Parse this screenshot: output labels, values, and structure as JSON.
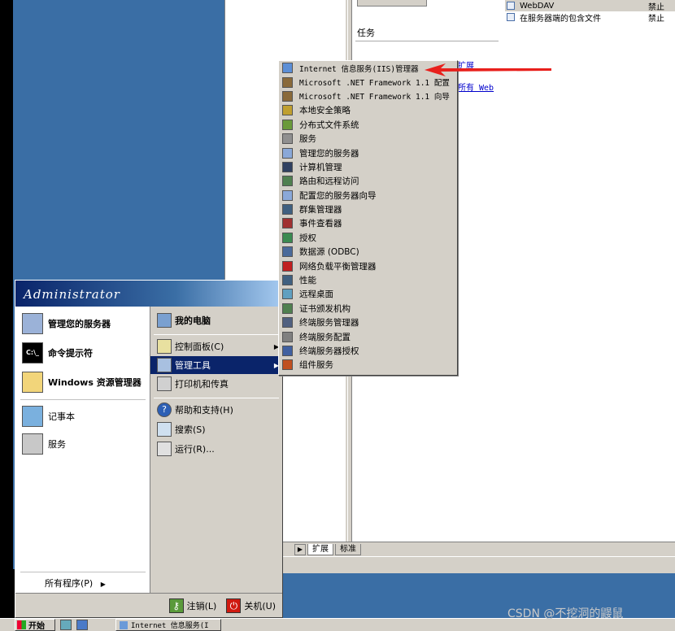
{
  "iis_window": {
    "tasks_label": "任务",
    "links": [
      "扩展",
      "所有 Web"
    ],
    "list": [
      {
        "name": "WebDAV",
        "status": "禁止"
      },
      {
        "name": "在服务器端的包含文件",
        "status": "禁止"
      }
    ],
    "tabs": [
      "扩展",
      "标准"
    ]
  },
  "start_menu": {
    "user": "Administrator",
    "left_items": [
      {
        "label": "管理您的服务器",
        "icon": "server-icon"
      },
      {
        "label": "命令提示符",
        "icon": "console-icon"
      },
      {
        "label": "Windows 资源管理器",
        "icon": "explorer-icon"
      },
      {
        "label": "记事本",
        "icon": "notepad-icon"
      },
      {
        "label": "服务",
        "icon": "services-icon"
      }
    ],
    "all_programs": "所有程序(P)",
    "right_items": [
      {
        "label": "我的电脑",
        "icon": "computer-icon"
      },
      {
        "label": "控制面板(C)",
        "icon": "control-panel-icon"
      },
      {
        "label": "管理工具",
        "icon": "admin-tools-icon"
      },
      {
        "label": "打印机和传真",
        "icon": "printer-icon"
      },
      {
        "label": "帮助和支持(H)",
        "icon": "help-icon"
      },
      {
        "label": "搜索(S)",
        "icon": "search-icon"
      },
      {
        "label": "运行(R)...",
        "icon": "run-icon"
      }
    ],
    "logoff": "注销(L)",
    "shutdown": "关机(U)"
  },
  "admin_tools_menu": [
    "Internet 信息服务(IIS)管理器",
    "Microsoft .NET Framework 1.1 配置",
    "Microsoft .NET Framework 1.1 向导",
    "本地安全策略",
    "分布式文件系统",
    "服务",
    "管理您的服务器",
    "计算机管理",
    "路由和远程访问",
    "配置您的服务器向导",
    "群集管理器",
    "事件查看器",
    "授权",
    "数据源 (ODBC)",
    "网络负载平衡管理器",
    "性能",
    "远程桌面",
    "证书颁发机构",
    "终端服务管理器",
    "终端服务配置",
    "终端服务器授权",
    "组件服务"
  ],
  "taskbar": {
    "start": "开始",
    "task": "Internet 信息服务(I"
  },
  "watermark": "CSDN @不挖洞的鼹鼠",
  "colors": {
    "desktop": "#3a6ea5",
    "highlight": "#0a246a",
    "arrow": "#e8201c"
  }
}
